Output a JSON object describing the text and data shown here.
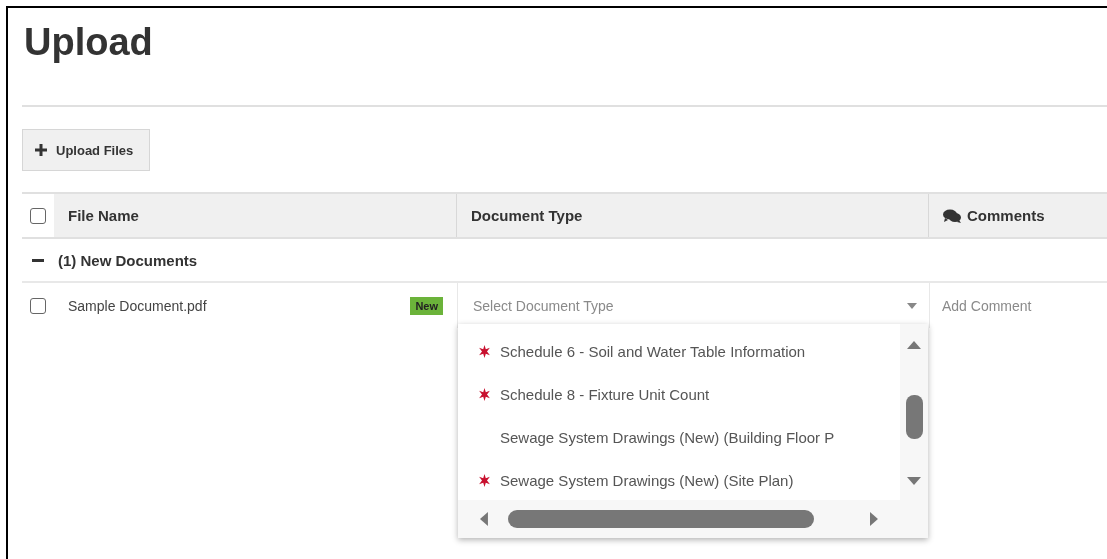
{
  "title": "Upload",
  "upload_button": {
    "label": "Upload Files"
  },
  "table": {
    "select_all": {
      "checked": false
    },
    "columns": [
      {
        "label": "File Name"
      },
      {
        "label": "Document Type"
      },
      {
        "label": "Comments"
      }
    ],
    "groups": [
      {
        "label": "(1) New Documents",
        "expanded": true,
        "rows": [
          {
            "checked": false,
            "file_name": "Sample Document.pdf",
            "badge": "New",
            "document_type": {
              "placeholder": "Select Document Type",
              "open": true,
              "options": [
                {
                  "label": "Schedule 6 - Soil and Water Table Information",
                  "required": true
                },
                {
                  "label": "Schedule 8 - Fixture Unit Count",
                  "required": true
                },
                {
                  "label": "Sewage System Drawings (New) (Building Floor P",
                  "required": false
                },
                {
                  "label": "Sewage System Drawings (New) (Site Plan)",
                  "required": true
                }
              ]
            },
            "comment": {
              "placeholder": "Add Comment"
            }
          }
        ]
      }
    ]
  }
}
